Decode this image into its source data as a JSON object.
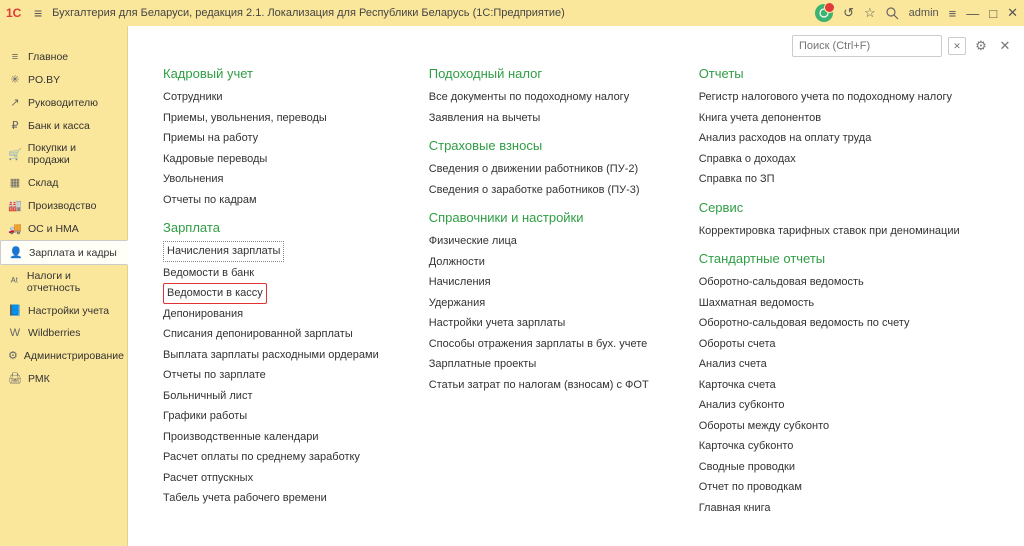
{
  "titlebar": {
    "logo": "1C",
    "title": "Бухгалтерия для Беларуси, редакция 2.1. Локализация для Республики Беларусь   (1С:Предприятие)",
    "user": "admin"
  },
  "search": {
    "placeholder": "Поиск (Ctrl+F)"
  },
  "sidebar": [
    {
      "icon": "≡",
      "label": "Главное"
    },
    {
      "icon": "✳",
      "label": "PO.BY"
    },
    {
      "icon": "↗",
      "label": "Руководителю"
    },
    {
      "icon": "₽",
      "label": "Банк и касса"
    },
    {
      "icon": "🛒",
      "label": "Покупки и продажи"
    },
    {
      "icon": "▦",
      "label": "Склад"
    },
    {
      "icon": "🏭",
      "label": "Производство"
    },
    {
      "icon": "🚚",
      "label": "ОС и НМА"
    },
    {
      "icon": "👤",
      "label": "Зарплата и кадры"
    },
    {
      "icon": "ᴬᵗ",
      "label": "Налоги и отчетность"
    },
    {
      "icon": "📘",
      "label": "Настройки учета"
    },
    {
      "icon": "W",
      "label": "Wildberries"
    },
    {
      "icon": "⚙",
      "label": "Администрирование"
    },
    {
      "icon": "🖨",
      "label": "РМК"
    }
  ],
  "active_sidebar_index": 8,
  "columns": [
    [
      {
        "title": "Кадровый учет",
        "items": [
          "Сотрудники",
          "Приемы, увольнения, переводы",
          "Приемы на работу",
          "Кадровые переводы",
          "Увольнения",
          "Отчеты по кадрам"
        ]
      },
      {
        "title": "Зарплата",
        "items": [
          "Начисления зарплаты",
          "Ведомости в банк",
          "Ведомости в кассу",
          "Депонирования",
          "Списания депонированной зарплаты",
          "Выплата зарплаты расходными ордерами",
          "Отчеты по зарплате",
          "Больничный лист",
          "Графики работы",
          "Производственные календари",
          "Расчет оплаты по среднему заработку",
          "Расчет отпускных",
          "Табель учета рабочего времени"
        ],
        "highlight": {
          "0": "boxed1",
          "2": "boxed2"
        }
      }
    ],
    [
      {
        "title": "Подоходный налог",
        "items": [
          "Все документы по подоходному налогу",
          "Заявления на вычеты"
        ]
      },
      {
        "title": "Страховые взносы",
        "items": [
          "Сведения о движении работников (ПУ-2)",
          "Сведения о заработке работников (ПУ-3)"
        ]
      },
      {
        "title": "Справочники и настройки",
        "items": [
          "Физические лица",
          "Должности",
          "Начисления",
          "Удержания",
          "Настройки учета зарплаты",
          "Способы отражения зарплаты в бух. учете",
          "Зарплатные проекты",
          "Статьи затрат по налогам (взносам) с ФОТ"
        ]
      }
    ],
    [
      {
        "title": "Отчеты",
        "items": [
          "Регистр налогового учета по подоходному налогу",
          "Книга учета депонентов",
          "Анализ расходов на оплату труда",
          "Справка о доходах",
          "Справка по ЗП"
        ]
      },
      {
        "title": "Сервис",
        "items": [
          "Корректировка тарифных ставок при деноминации"
        ]
      },
      {
        "title": "Стандартные отчеты",
        "items": [
          "Оборотно-сальдовая ведомость",
          "Шахматная ведомость",
          "Оборотно-сальдовая ведомость по счету",
          "Обороты счета",
          "Анализ счета",
          "Карточка счета",
          "Анализ субконто",
          "Обороты между субконто",
          "Карточка субконто",
          "Сводные проводки",
          "Отчет по проводкам",
          "Главная книга"
        ]
      }
    ]
  ]
}
